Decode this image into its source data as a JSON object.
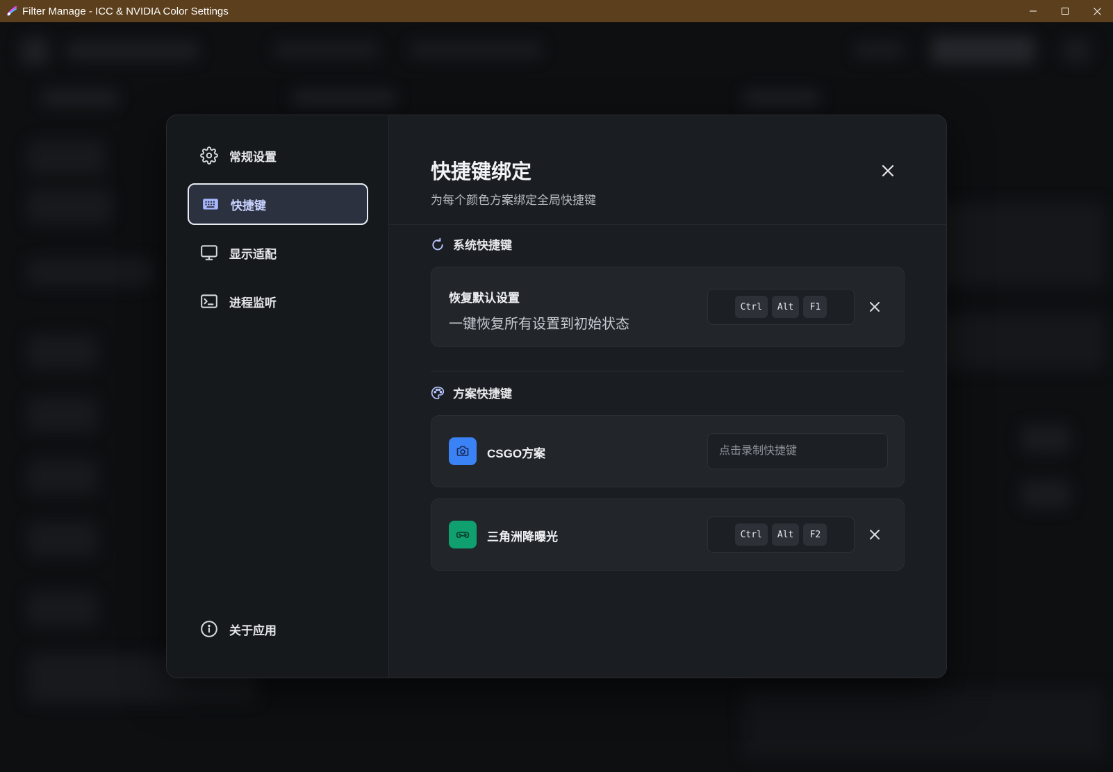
{
  "window": {
    "title": "Filter Manage - ICC & NVIDIA Color Settings",
    "minimize_glyph": "—",
    "maximize_glyph": "☐",
    "close_glyph": "✕"
  },
  "sidebar": {
    "items": [
      {
        "label": "常规设置",
        "icon": "gear-icon"
      },
      {
        "label": "快捷键",
        "icon": "keyboard-icon",
        "active": true
      },
      {
        "label": "显示适配",
        "icon": "monitor-icon"
      },
      {
        "label": "进程监听",
        "icon": "terminal-icon"
      }
    ],
    "about": {
      "label": "关于应用",
      "icon": "info-icon"
    }
  },
  "header": {
    "title": "快捷键绑定",
    "subtitle": "为每个颜色方案绑定全局快捷键"
  },
  "system_section": {
    "title": "系统快捷键",
    "icon": "refresh-icon",
    "items": [
      {
        "title": "恢复默认设置",
        "description": "一键恢复所有设置到初始状态",
        "keys": [
          "Ctrl",
          "Alt",
          "F1"
        ]
      }
    ]
  },
  "scheme_section": {
    "title": "方案快捷键",
    "icon": "palette-icon",
    "items": [
      {
        "name": "CSGO方案",
        "icon": "camera-icon",
        "color": "#3b82f6",
        "placeholder": "点击录制快捷键",
        "keys": []
      },
      {
        "name": "三角洲降曝光",
        "icon": "gamepad-icon",
        "color": "#10a070",
        "keys": [
          "Ctrl",
          "Alt",
          "F2"
        ]
      }
    ]
  },
  "colors": {
    "titlebar": "#5c3f1c",
    "accent": "#a8b8ff"
  }
}
